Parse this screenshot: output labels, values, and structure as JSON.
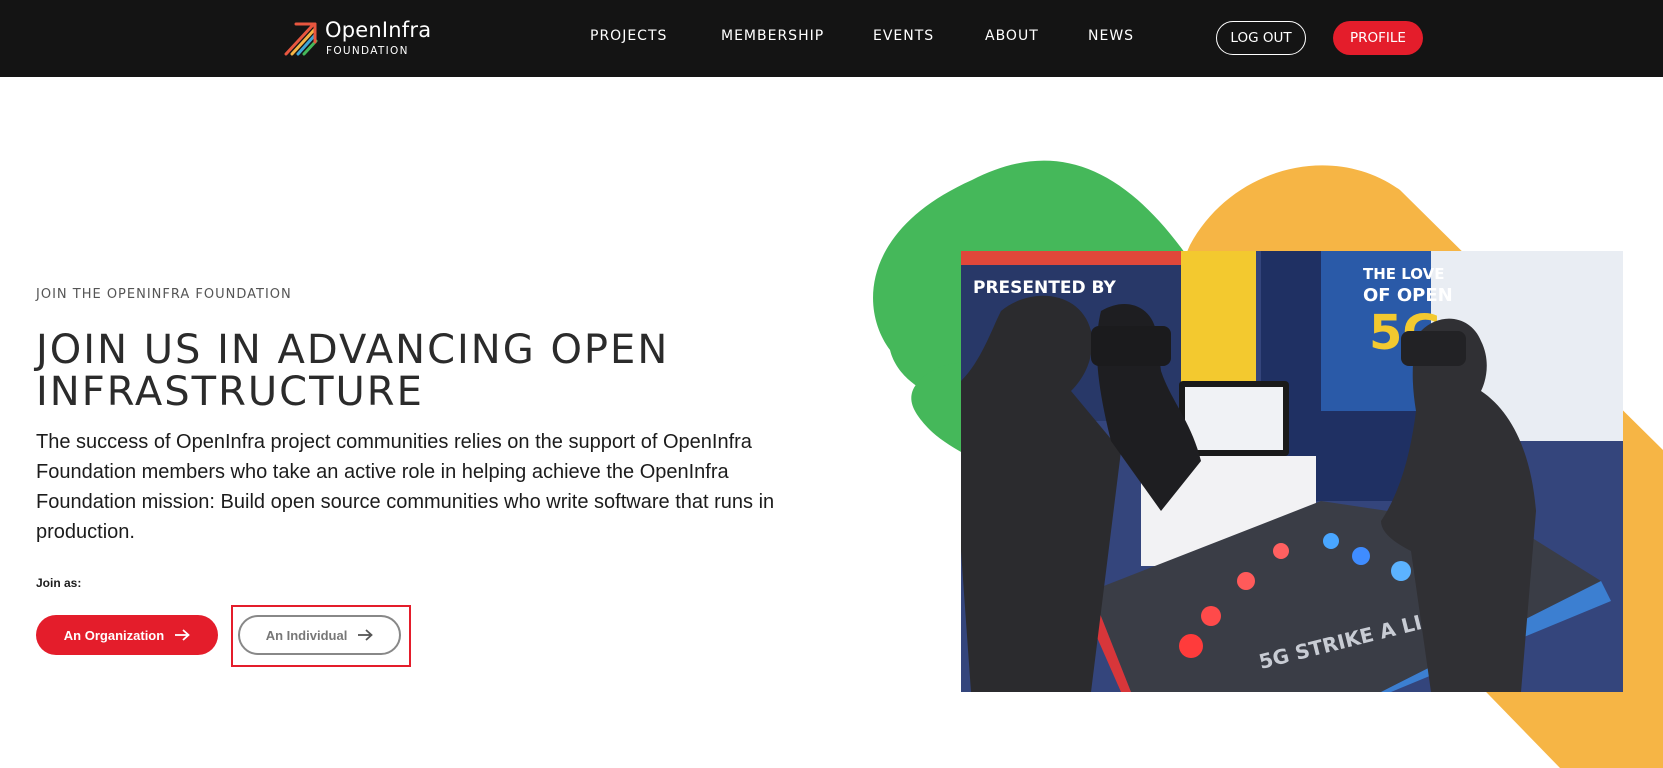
{
  "nav": {
    "logo": {
      "name": "OpenInfra",
      "sub": "FOUNDATION"
    },
    "links": [
      "PROJECTS",
      "MEMBERSHIP",
      "EVENTS",
      "ABOUT",
      "NEWS"
    ],
    "logout_label": "LOG OUT",
    "profile_label": "PROFILE"
  },
  "hero": {
    "eyebrow": "JOIN THE OPENINFRA FOUNDATION",
    "headline": "JOIN US IN ADVANCING OPEN INFRASTRUCTURE",
    "description": "The success of OpenInfra project communities relies on the support of OpenInfra Foundation members who take an active role in helping achieve the OpenInfra Foundation mission: Build open source communities who write software that runs in production.",
    "join_label": "Join as:",
    "org_button": "An Organization",
    "individual_button": "An Individual"
  },
  "photo": {
    "sign_left": "PRESENTED BY",
    "sign_right_1": "THE LOVE",
    "sign_right_2": "OF OPEN",
    "sign_right_3": "5G",
    "table_text": "5G STRIKE A LIGHT"
  },
  "colors": {
    "nav_bg": "#141414",
    "accent_red": "#e41d2b",
    "blob_green": "#45b85a",
    "blob_orange": "#f6b545"
  },
  "icons": {
    "arrow": "arrow-right-icon",
    "logo": "openinfra-logo-icon"
  }
}
